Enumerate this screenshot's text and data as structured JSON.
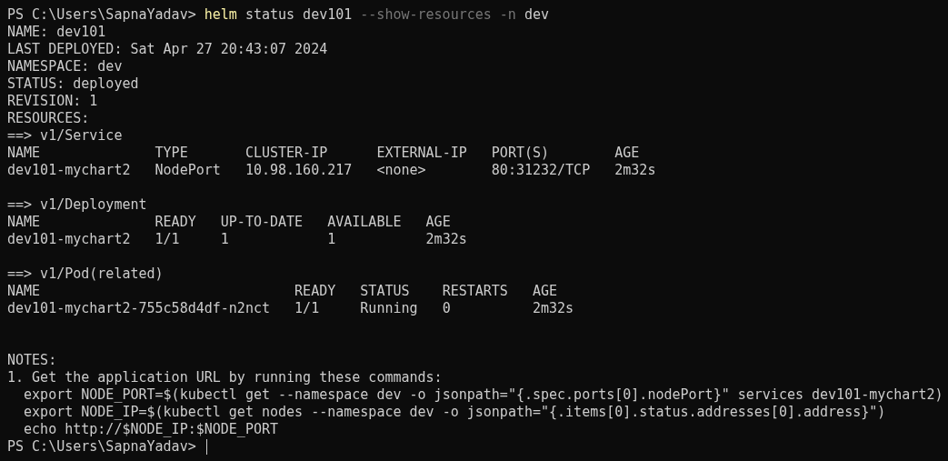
{
  "terminal": {
    "lines": [
      {
        "kind": "prompt",
        "prompt": "PS C:\\Users\\SapnaYadav> ",
        "cursor": false,
        "tokens": [
          {
            "kind": "command",
            "text": "helm"
          },
          {
            "kind": "arg",
            "text": "status dev101"
          },
          {
            "kind": "flag",
            "text": "--show-resources"
          },
          {
            "kind": "flag",
            "text": "-n"
          },
          {
            "kind": "arg",
            "text": "dev"
          }
        ]
      },
      {
        "kind": "text",
        "text": "NAME: dev101"
      },
      {
        "kind": "text",
        "text": "LAST DEPLOYED: Sat Apr 27 20:43:07 2024"
      },
      {
        "kind": "text",
        "text": "NAMESPACE: dev"
      },
      {
        "kind": "text",
        "text": "STATUS: deployed"
      },
      {
        "kind": "text",
        "text": "REVISION: 1"
      },
      {
        "kind": "text",
        "text": "RESOURCES:"
      },
      {
        "kind": "text",
        "text": "==> v1/Service"
      },
      {
        "kind": "text",
        "text": "NAME              TYPE       CLUSTER-IP      EXTERNAL-IP   PORT(S)        AGE"
      },
      {
        "kind": "text",
        "text": "dev101-mychart2   NodePort   10.98.160.217   <none>        80:31232/TCP   2m32s"
      },
      {
        "kind": "blank"
      },
      {
        "kind": "text",
        "text": "==> v1/Deployment"
      },
      {
        "kind": "text",
        "text": "NAME              READY   UP-TO-DATE   AVAILABLE   AGE"
      },
      {
        "kind": "text",
        "text": "dev101-mychart2   1/1     1            1           2m32s"
      },
      {
        "kind": "blank"
      },
      {
        "kind": "text",
        "text": "==> v1/Pod(related)"
      },
      {
        "kind": "text",
        "text": "NAME                               READY   STATUS    RESTARTS   AGE"
      },
      {
        "kind": "text",
        "text": "dev101-mychart2-755c58d4df-n2nct   1/1     Running   0          2m32s"
      },
      {
        "kind": "blank"
      },
      {
        "kind": "blank"
      },
      {
        "kind": "text",
        "text": "NOTES:"
      },
      {
        "kind": "text",
        "text": "1. Get the application URL by running these commands:"
      },
      {
        "kind": "text",
        "text": "  export NODE_PORT=$(kubectl get --namespace dev -o jsonpath=\"{.spec.ports[0].nodePort}\" services dev101-mychart2)"
      },
      {
        "kind": "text",
        "text": "  export NODE_IP=$(kubectl get nodes --namespace dev -o jsonpath=\"{.items[0].status.addresses[0].address}\")"
      },
      {
        "kind": "text",
        "text": "  echo http://$NODE_IP:$NODE_PORT"
      },
      {
        "kind": "prompt",
        "prompt": "PS C:\\Users\\SapnaYadav> ",
        "cursor": true
      }
    ]
  }
}
